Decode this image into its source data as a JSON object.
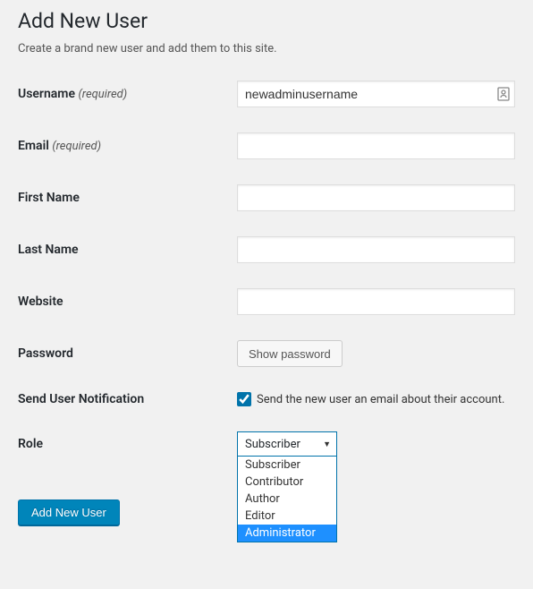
{
  "page": {
    "title": "Add New User",
    "subtitle": "Create a brand new user and add them to this site."
  },
  "fields": {
    "username": {
      "label": "Username",
      "hint": "(required)",
      "value": "newadminusername"
    },
    "email": {
      "label": "Email",
      "hint": "(required)",
      "value": ""
    },
    "first_name": {
      "label": "First Name",
      "value": ""
    },
    "last_name": {
      "label": "Last Name",
      "value": ""
    },
    "website": {
      "label": "Website",
      "value": ""
    },
    "password": {
      "label": "Password",
      "button": "Show password"
    },
    "notification": {
      "label": "Send User Notification",
      "checkbox_label": "Send the new user an email about their account.",
      "checked": true
    },
    "role": {
      "label": "Role",
      "selected": "Subscriber",
      "options": [
        "Subscriber",
        "Contributor",
        "Author",
        "Editor",
        "Administrator"
      ],
      "highlighted": "Administrator"
    }
  },
  "submit": {
    "label": "Add New User"
  }
}
